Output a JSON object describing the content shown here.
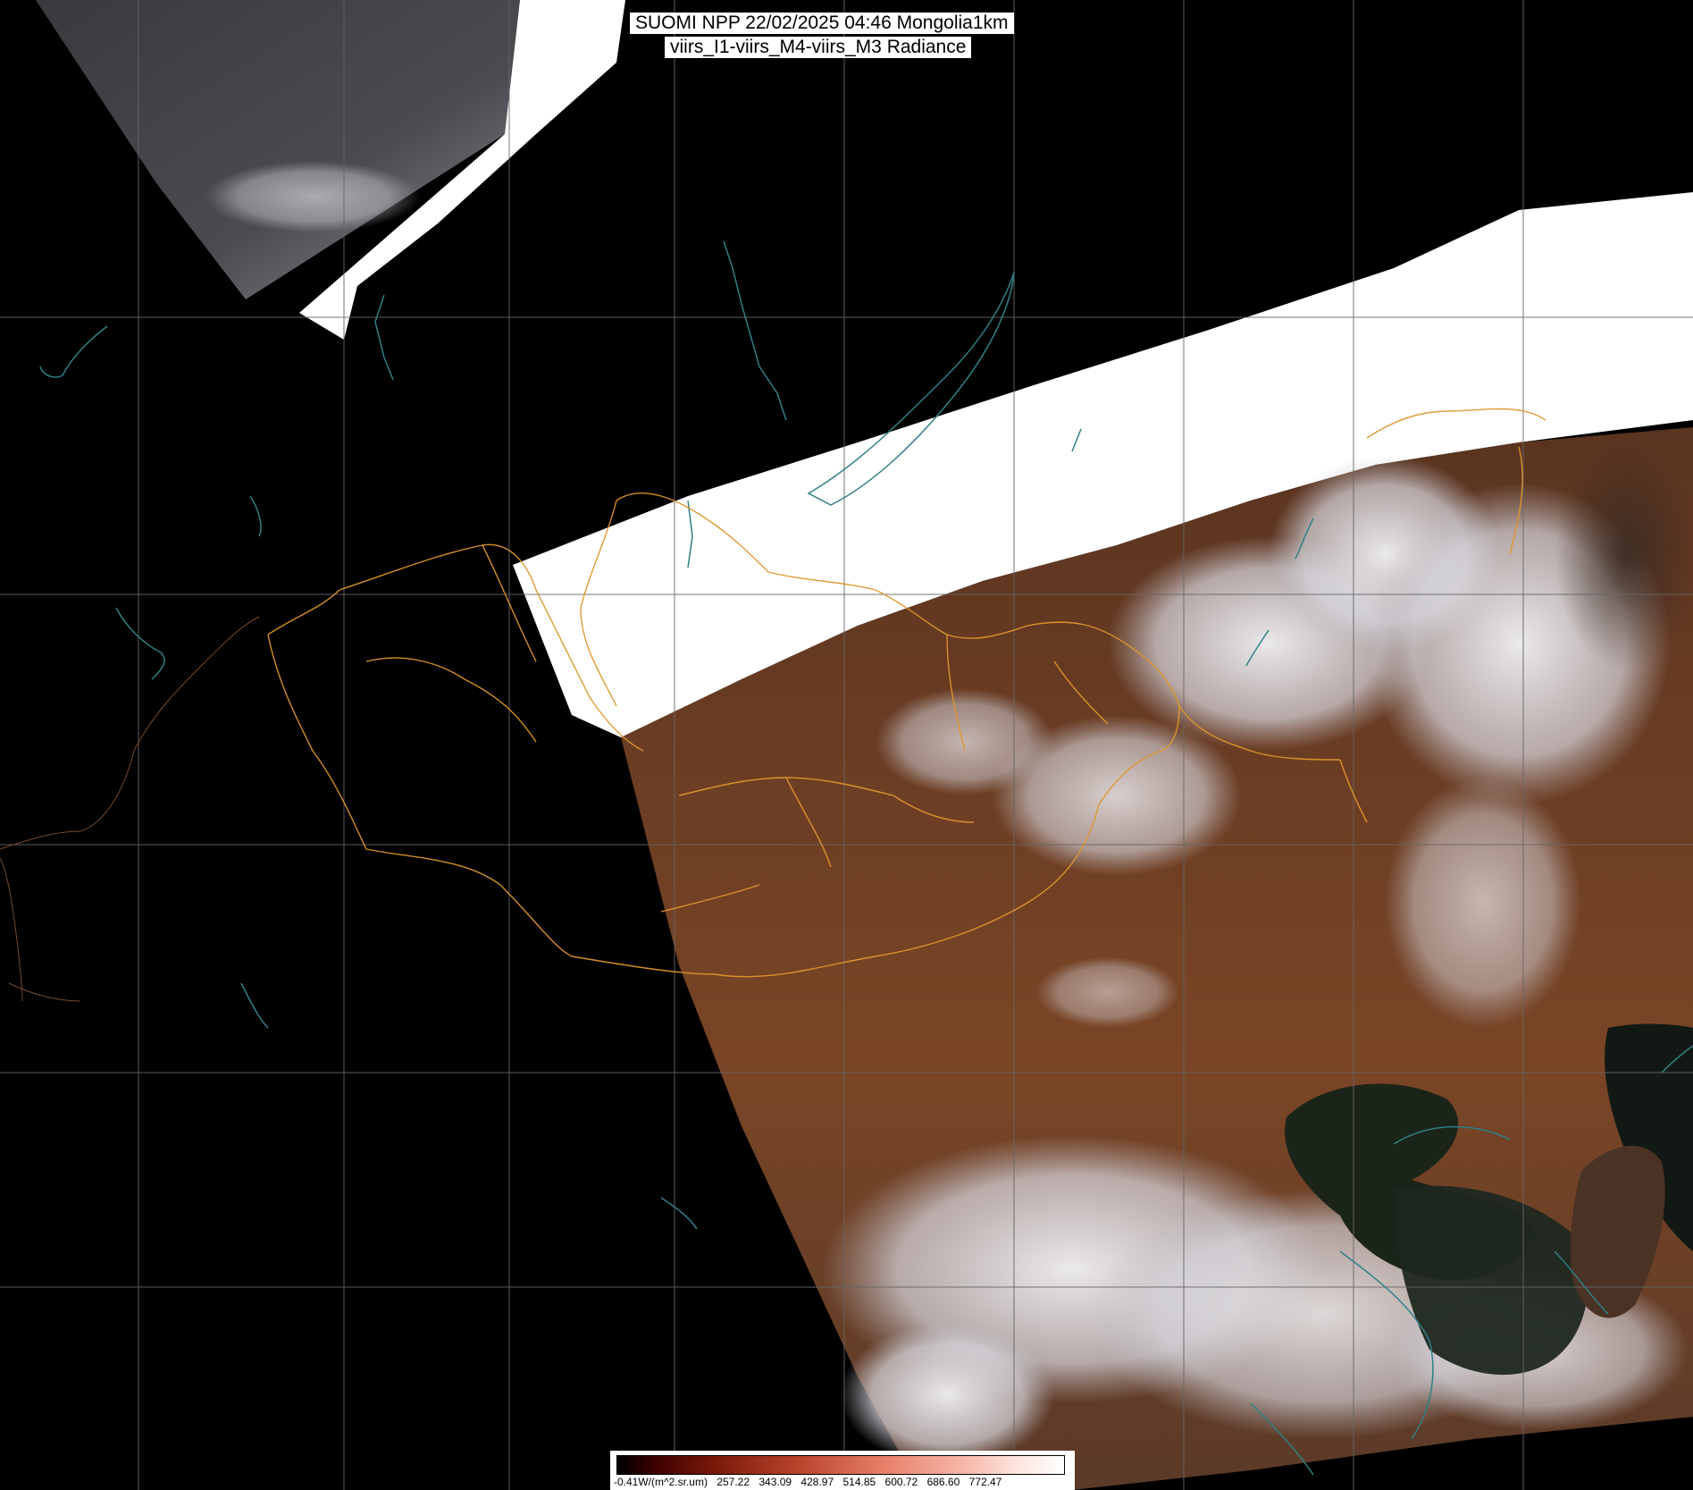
{
  "title": {
    "line1": "SUOMI NPP 22/02/2025 04:46 Mongolia1km",
    "line2": "viirs_I1-viirs_M4-viirs_M3 Radiance"
  },
  "colorbar": {
    "unit_label": "-0.41W/(m^2.sr.um)",
    "ticks": [
      "257.22",
      "343.09",
      "428.97",
      "514.85",
      "600.72",
      "686.60",
      "772.47"
    ]
  },
  "colors": {
    "background": "#000000",
    "saturated_swath": "#ffffff",
    "land": "#6b3a22",
    "cloud_snow": "#e4e4ea",
    "sea": "#1b2418",
    "grid_lines": "#666666",
    "coastline": "#2f7f86",
    "admin_borders": "#e0962c"
  }
}
